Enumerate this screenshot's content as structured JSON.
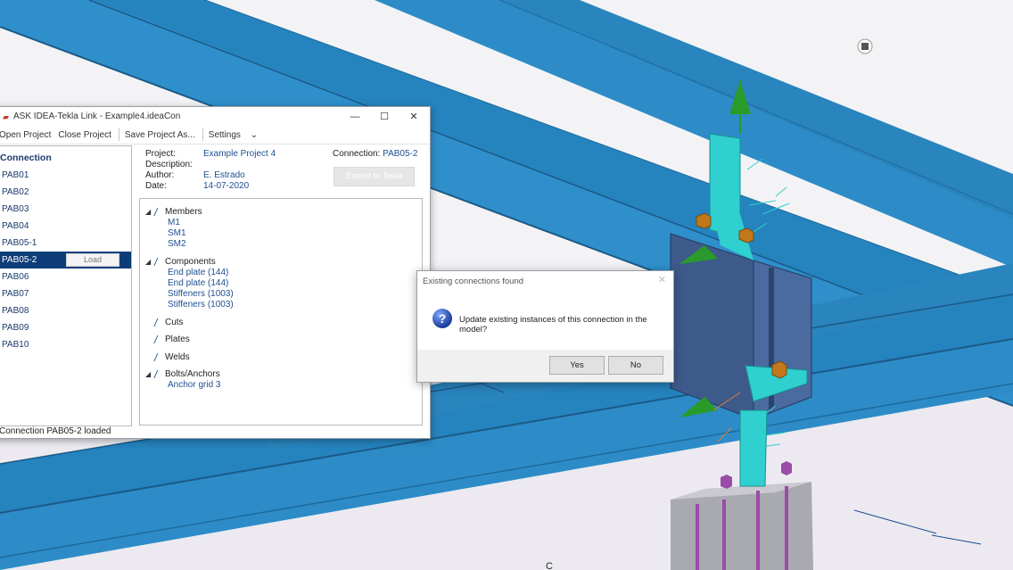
{
  "window": {
    "title": "ASK IDEA-Tekla Link - Example4.ideaCon",
    "controls": {
      "minimize": "—",
      "maximize": "☐",
      "close": "✕"
    }
  },
  "menu": {
    "open_project": "Open Project",
    "close_project": "Close Project",
    "save_project_as": "Save Project As...",
    "settings": "Settings",
    "settings_caret": "⌄"
  },
  "connection_list": {
    "header": "Connection",
    "items": [
      "PAB01",
      "PAB02",
      "PAB03",
      "PAB04",
      "PAB05-1",
      "PAB05-2",
      "PAB06",
      "PAB07",
      "PAB08",
      "PAB09",
      "PAB10"
    ],
    "selected_index": 5,
    "load_label": "Load"
  },
  "project_info": {
    "project_label": "Project:",
    "project_value": "Example Project 4",
    "description_label": "Description:",
    "description_value": "",
    "author_label": "Author:",
    "author_value": "E. Estrado",
    "date_label": "Date:",
    "date_value": "14-07-2020",
    "connection_label": "Connection:",
    "connection_value": "PAB05-2",
    "export_label": "Export to Tekla"
  },
  "tree": {
    "members": {
      "label": "Members",
      "children": [
        "M1",
        "SM1",
        "SM2"
      ]
    },
    "components": {
      "label": "Components",
      "children": [
        "End plate (144)",
        "End plate (144)",
        "Stiffeners (1003)",
        "Stiffeners (1003)"
      ]
    },
    "cuts": {
      "label": "Cuts"
    },
    "plates": {
      "label": "Plates"
    },
    "welds": {
      "label": "Welds"
    },
    "bolts": {
      "label": "Bolts/Anchors",
      "children": [
        "Anchor grid 3"
      ]
    }
  },
  "status_text": "Connection PAB05-2 loaded",
  "dialog": {
    "title": "Existing connections found",
    "close": "✕",
    "icon": "question-icon",
    "icon_glyph": "?",
    "message": "Update existing instances of this connection in the model?",
    "yes": "Yes",
    "no": "No"
  },
  "viewport": {
    "axis_label": "C",
    "colors": {
      "beam": "#2a88c3",
      "beam_dark": "#1c5f8f",
      "plate": "#3d5a8a",
      "stiffener": "#2fd0cf",
      "bolt": "#c07818",
      "anchor": "#9b4ca8",
      "arrow": "#2a9a2a"
    }
  }
}
